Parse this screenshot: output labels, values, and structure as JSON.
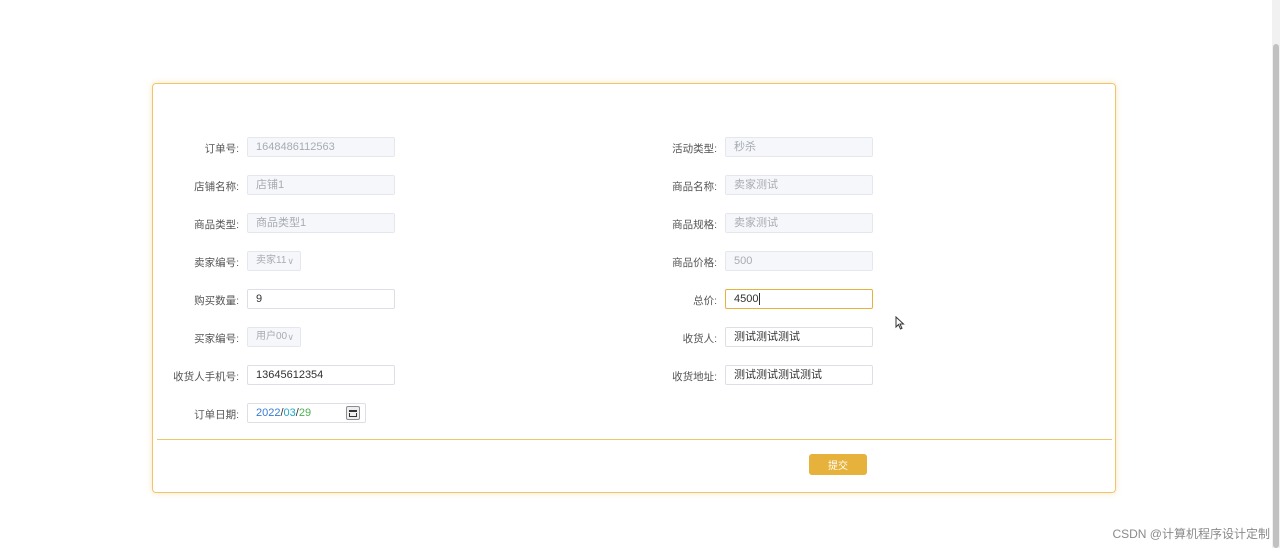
{
  "form": {
    "left": [
      {
        "label": "订单号:",
        "value": "1648486112563",
        "kind": "disabled"
      },
      {
        "label": "店铺名称:",
        "value": "店铺1",
        "kind": "disabled"
      },
      {
        "label": "商品类型:",
        "value": "商品类型1",
        "kind": "disabled"
      },
      {
        "label": "卖家编号:",
        "value": "卖家11",
        "kind": "select-disabled"
      },
      {
        "label": "购买数量:",
        "value": "9",
        "kind": "input"
      },
      {
        "label": "买家编号:",
        "value": "用户00",
        "kind": "select-disabled"
      },
      {
        "label": "收货人手机号:",
        "value": "13645612354",
        "kind": "input"
      },
      {
        "label": "订单日期:",
        "kind": "date",
        "date": {
          "year": "2022",
          "month": "03",
          "day": "29"
        }
      }
    ],
    "right": [
      {
        "label": "活动类型:",
        "value": "秒杀",
        "kind": "disabled"
      },
      {
        "label": "商品名称:",
        "value": "卖家测试",
        "kind": "disabled"
      },
      {
        "label": "商品规格:",
        "value": "卖家测试",
        "kind": "disabled"
      },
      {
        "label": "商品价格:",
        "value": "500",
        "kind": "disabled"
      },
      {
        "label": "总价:",
        "value": "4500",
        "kind": "input-focused"
      },
      {
        "label": "收货人:",
        "value": "测试测试测试",
        "kind": "input"
      },
      {
        "label": "收货地址:",
        "value": "测试测试测试测试",
        "kind": "input"
      }
    ],
    "submit_label": "提交"
  },
  "watermark": "CSDN @计算机程序设计定制",
  "colors": {
    "accent": "#e6b23c",
    "border": "#f0c66a"
  }
}
